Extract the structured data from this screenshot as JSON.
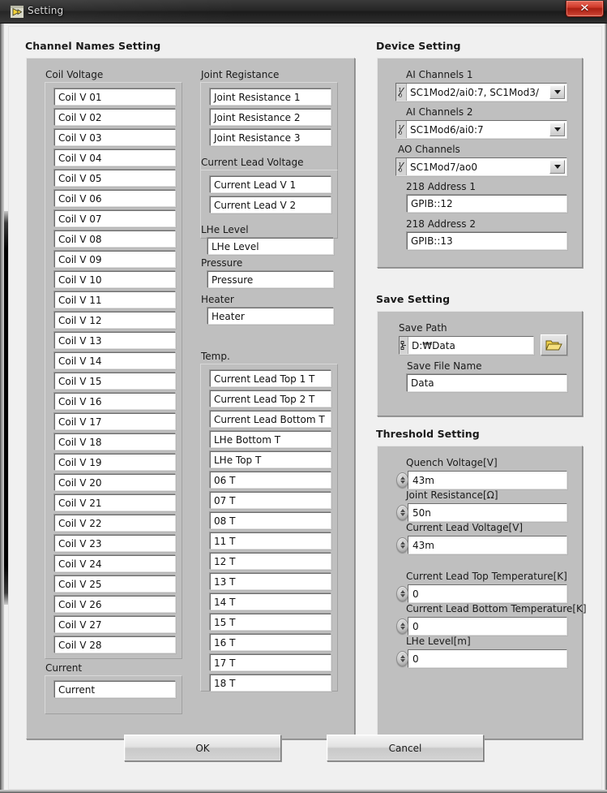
{
  "window": {
    "title": "Setting",
    "icon": "labview-vi-icon",
    "close_label": "✕"
  },
  "sections": {
    "channel_names": "Channel Names Setting",
    "device": "Device Setting",
    "save": "Save Setting",
    "threshold": "Threshold Setting"
  },
  "channel_names": {
    "coil_voltage": {
      "label": "Coil Voltage",
      "fields": [
        "Coil V 01",
        "Coil V 02",
        "Coil V 03",
        "Coil V 04",
        "Coil V 05",
        "Coil V 06",
        "Coil V 07",
        "Coil V 08",
        "Coil V 09",
        "Coil V 10",
        "Coil V 11",
        "Coil V 12",
        "Coil V 13",
        "Coil V 14",
        "Coil V 15",
        "Coil V 16",
        "Coil V 17",
        "Coil V 18",
        "Coil V 19",
        "Coil V 20",
        "Coil V 21",
        "Coil V 22",
        "Coil V 23",
        "Coil V 24",
        "Coil V 25",
        "Coil V 26",
        "Coil V 27",
        "Coil V 28"
      ]
    },
    "current": {
      "label": "Current",
      "fields": [
        "Current"
      ]
    },
    "joint_resistance": {
      "label": "Joint Registаnce",
      "fields": [
        "Joint Resistance 1",
        "Joint Resistance 2",
        "Joint Resistance 3"
      ]
    },
    "current_lead_voltage": {
      "label": "Current Lead Voltage",
      "fields": [
        "Current Lead V 1",
        "Current Lead V 2"
      ]
    },
    "lhe_level": {
      "label": "LHe Level",
      "fields": [
        "LHe Level"
      ]
    },
    "pressure": {
      "label": "Pressure",
      "fields": [
        "Pressure"
      ]
    },
    "heater": {
      "label": "Heater",
      "fields": [
        "Heater"
      ]
    },
    "temp": {
      "label": "Temp.",
      "fields": [
        "Current Lead Top 1 T",
        "Current Lead Top 2 T",
        "Current Lead Bottom T",
        "LHe Bottom T",
        "LHe Top T",
        "06 T",
        "07 T",
        "08 T",
        "11 T",
        "12 T",
        "13 T",
        "14 T",
        "15 T",
        "16 T",
        "17 T",
        "18 T"
      ]
    }
  },
  "device_setting": {
    "ai_channels_1": {
      "label": "AI Channels 1",
      "value": "SC1Mod2/ai0:7, SC1Mod3/"
    },
    "ai_channels_2": {
      "label": "AI Channels 2",
      "value": "SC1Mod6/ai0:7"
    },
    "ao_channels": {
      "label": "AO Channels",
      "value": "SC1Mod7/ao0"
    },
    "addr_218_1": {
      "label": "218 Address 1",
      "value": "GPIB::12"
    },
    "addr_218_2": {
      "label": "218 Address 2",
      "value": "GPIB::13"
    }
  },
  "save_setting": {
    "save_path": {
      "label": "Save Path",
      "value": "D:₩Data"
    },
    "browse_icon": "open-folder-icon",
    "save_file_name": {
      "label": "Save File Name",
      "value": "Data"
    }
  },
  "threshold_setting": [
    {
      "label": "Quench Voltage[V]",
      "value": "43m"
    },
    {
      "label": "Joint Resistance[Ω]",
      "value": "50n"
    },
    {
      "label": "Current Lead Voltage[V]",
      "value": "43m"
    },
    {
      "label": "Current Lead Top Temperature[K]",
      "value": "0"
    },
    {
      "label": "Current Lead Bottom Temperature[K]",
      "value": "0"
    },
    {
      "label": "LHe Level[m]",
      "value": "0"
    }
  ],
  "buttons": {
    "ok": "OK",
    "cancel": "Cancel"
  },
  "colors": {
    "panel": "#bfbfbf",
    "client": "#f0f0f0",
    "field": "#ffffff",
    "titlebar": "#262626",
    "close": "#cf3a2a",
    "folder_icon": "#e8c84a"
  }
}
